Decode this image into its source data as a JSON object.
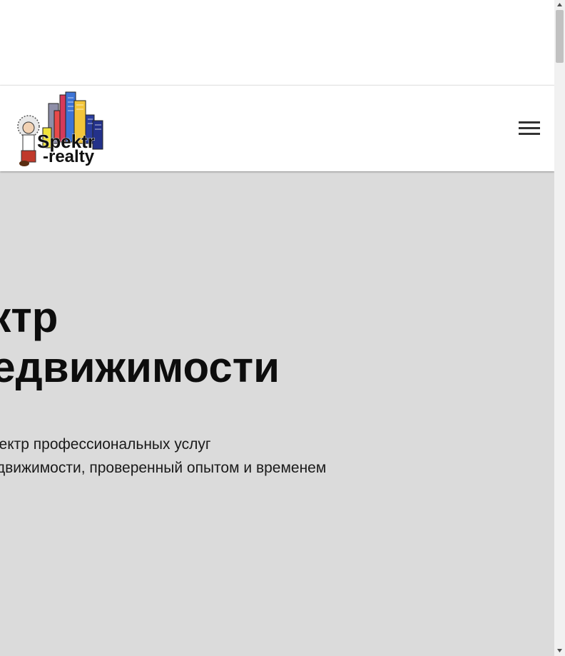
{
  "header": {
    "logo": {
      "brand_line1": "Spektr",
      "brand_line2": "-realty",
      "icon": "city-buildings-logo"
    },
    "menu_icon": "hamburger-menu-icon"
  },
  "hero": {
    "title_lines": [
      "ектр",
      "недвижимости"
    ],
    "subtitle_lines": [
      "Спектр профессиональных услуг",
      "недвижимости, проверенный опытом и временем"
    ]
  },
  "colors": {
    "hero_background": "#dbdbdb",
    "header_background": "#ffffff",
    "title_color": "#0d0d0d"
  }
}
